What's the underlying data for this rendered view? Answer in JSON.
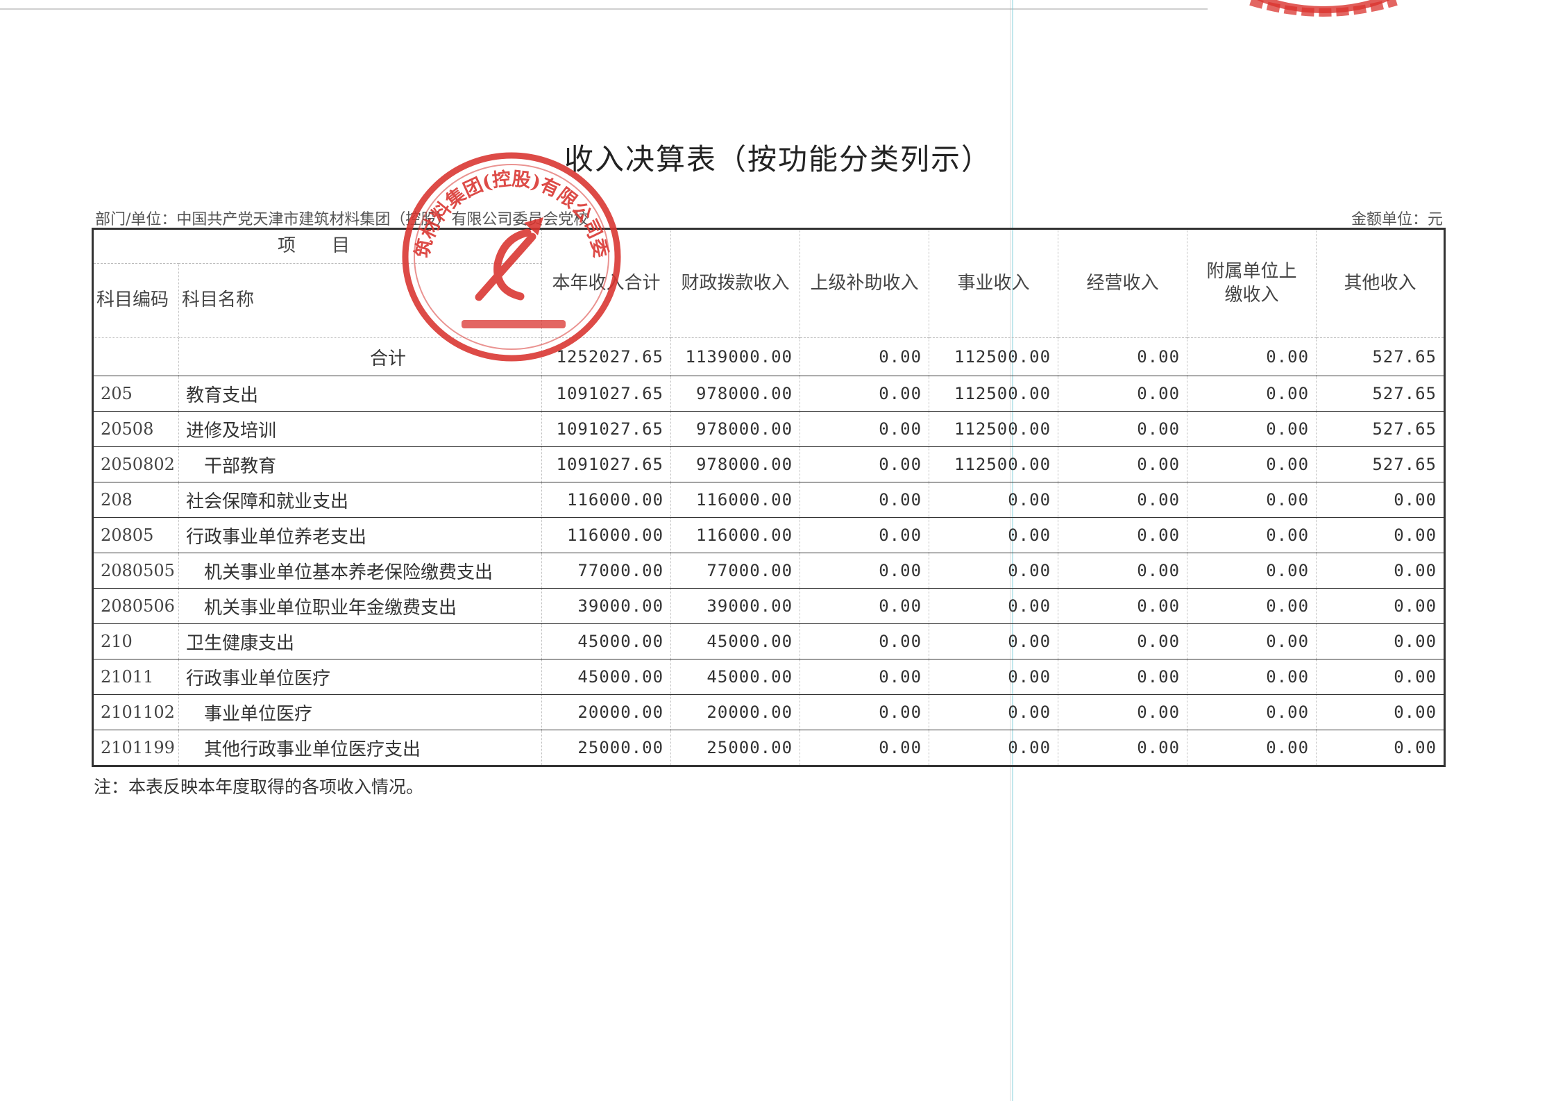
{
  "document": {
    "title": "收入决算表（按功能分类列示）",
    "department": "部门/单位：中国共产党天津市建筑材料集团（控股）有限公司委员会党校",
    "unit": "金额单位：元",
    "note": "注：本表反映本年度取得的各项收入情况。"
  },
  "table": {
    "item_header": "项　　目",
    "code_header": "科目编码",
    "name_header": "科目名称",
    "columns": [
      "本年收入合计",
      "财政拨款收入",
      "上级补助收入",
      "事业收入",
      "经营收入",
      "附属单位上缴收入",
      "其他收入"
    ],
    "total": {
      "label": "合计",
      "values": [
        "1252027.65",
        "1139000.00",
        "0.00",
        "112500.00",
        "0.00",
        "0.00",
        "527.65"
      ]
    },
    "rows": [
      {
        "code": "205",
        "name": "教育支出",
        "level": 1,
        "values": [
          "1091027.65",
          "978000.00",
          "0.00",
          "112500.00",
          "0.00",
          "0.00",
          "527.65"
        ]
      },
      {
        "code": "20508",
        "name": "进修及培训",
        "level": 1,
        "values": [
          "1091027.65",
          "978000.00",
          "0.00",
          "112500.00",
          "0.00",
          "0.00",
          "527.65"
        ]
      },
      {
        "code": "2050802",
        "name": "干部教育",
        "level": 2,
        "values": [
          "1091027.65",
          "978000.00",
          "0.00",
          "112500.00",
          "0.00",
          "0.00",
          "527.65"
        ]
      },
      {
        "code": "208",
        "name": "社会保障和就业支出",
        "level": 1,
        "values": [
          "116000.00",
          "116000.00",
          "0.00",
          "0.00",
          "0.00",
          "0.00",
          "0.00"
        ]
      },
      {
        "code": "20805",
        "name": "行政事业单位养老支出",
        "level": 1,
        "values": [
          "116000.00",
          "116000.00",
          "0.00",
          "0.00",
          "0.00",
          "0.00",
          "0.00"
        ]
      },
      {
        "code": "2080505",
        "name": "机关事业单位基本养老保险缴费支出",
        "level": 2,
        "values": [
          "77000.00",
          "77000.00",
          "0.00",
          "0.00",
          "0.00",
          "0.00",
          "0.00"
        ]
      },
      {
        "code": "2080506",
        "name": "机关事业单位职业年金缴费支出",
        "level": 2,
        "values": [
          "39000.00",
          "39000.00",
          "0.00",
          "0.00",
          "0.00",
          "0.00",
          "0.00"
        ]
      },
      {
        "code": "210",
        "name": "卫生健康支出",
        "level": 1,
        "values": [
          "45000.00",
          "45000.00",
          "0.00",
          "0.00",
          "0.00",
          "0.00",
          "0.00"
        ]
      },
      {
        "code": "21011",
        "name": "行政事业单位医疗",
        "level": 1,
        "values": [
          "45000.00",
          "45000.00",
          "0.00",
          "0.00",
          "0.00",
          "0.00",
          "0.00"
        ]
      },
      {
        "code": "2101102",
        "name": "事业单位医疗",
        "level": 2,
        "values": [
          "20000.00",
          "20000.00",
          "0.00",
          "0.00",
          "0.00",
          "0.00",
          "0.00"
        ]
      },
      {
        "code": "2101199",
        "name": "其他行政事业单位医疗支出",
        "level": 2,
        "values": [
          "25000.00",
          "25000.00",
          "0.00",
          "0.00",
          "0.00",
          "0.00",
          "0.00"
        ]
      }
    ]
  },
  "seal": {
    "text": "天津市建筑材料集团(控股)有限公司委员会党校",
    "color": "#d9332e"
  },
  "accent_colors": {
    "stamp_red": "#d9332e",
    "scan_line": "#78cdd7"
  }
}
